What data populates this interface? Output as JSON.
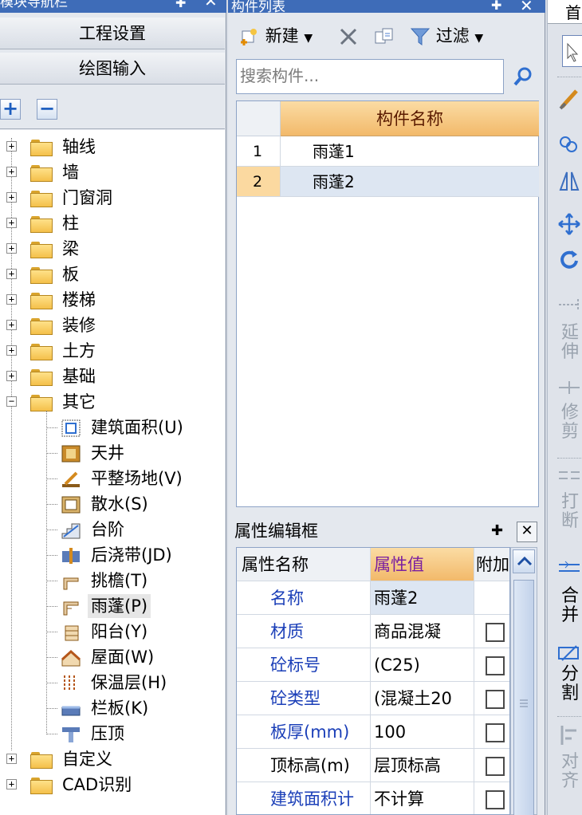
{
  "nav_panel": {
    "title": "模块导航栏",
    "pin_icon": "pin-icon",
    "close_icon": "close-icon",
    "buttons": [
      "工程设置",
      "绘图输入"
    ],
    "expand_all": "+",
    "collapse_all": "−",
    "tree": [
      {
        "label": "轴线",
        "expander": "+"
      },
      {
        "label": "墙",
        "expander": "+"
      },
      {
        "label": "门窗洞",
        "expander": "+"
      },
      {
        "label": "柱",
        "expander": "+"
      },
      {
        "label": "梁",
        "expander": "+"
      },
      {
        "label": "板",
        "expander": "+"
      },
      {
        "label": "楼梯",
        "expander": "+"
      },
      {
        "label": "装修",
        "expander": "+"
      },
      {
        "label": "土方",
        "expander": "+"
      },
      {
        "label": "基础",
        "expander": "+"
      },
      {
        "label": "其它",
        "expander": "−"
      },
      {
        "label": "自定义",
        "expander": "+"
      },
      {
        "label": "CAD识别",
        "expander": "+"
      }
    ],
    "other_children": [
      {
        "label": "建筑面积(U)",
        "icon": "building-area-icon"
      },
      {
        "label": "天井",
        "icon": "courtyard-icon"
      },
      {
        "label": "平整场地(V)",
        "icon": "site-leveling-icon"
      },
      {
        "label": "散水(S)",
        "icon": "apron-icon"
      },
      {
        "label": "台阶",
        "icon": "steps-icon"
      },
      {
        "label": "后浇带(JD)",
        "icon": "post-cast-strip-icon"
      },
      {
        "label": "挑檐(T)",
        "icon": "cornice-icon"
      },
      {
        "label": "雨蓬(P)",
        "icon": "canopy-icon"
      },
      {
        "label": "阳台(Y)",
        "icon": "balcony-icon"
      },
      {
        "label": "屋面(W)",
        "icon": "roof-icon"
      },
      {
        "label": "保温层(H)",
        "icon": "insulation-icon"
      },
      {
        "label": "栏板(K)",
        "icon": "parapet-icon"
      },
      {
        "label": "压顶",
        "icon": "coping-icon"
      }
    ],
    "selected_child": "雨蓬(P)"
  },
  "component_list": {
    "title": "构件列表",
    "toolbar": {
      "new_label": "新建",
      "new_icon": "new-component-icon",
      "delete_icon": "delete-icon",
      "copy_icon": "copy-icon",
      "filter_label": "过滤",
      "filter_icon": "filter-icon"
    },
    "search": {
      "placeholder": "搜索构件...",
      "icon": "search-icon"
    },
    "column_header": "构件名称",
    "rows": [
      {
        "num": "1",
        "name": "雨蓬1"
      },
      {
        "num": "2",
        "name": "雨蓬2"
      }
    ],
    "selected_row": 2
  },
  "property_editor": {
    "title": "属性编辑框",
    "headers": [
      "属性名称",
      "属性值",
      "附加"
    ],
    "rows": [
      {
        "name": "名称",
        "value": "雨蓬2",
        "checkbox": false,
        "blue": true
      },
      {
        "name": "材质",
        "value": "商品混凝",
        "checkbox": true,
        "blue": true
      },
      {
        "name": "砼标号",
        "value": "(C25)",
        "checkbox": true,
        "blue": true
      },
      {
        "name": "砼类型",
        "value": "(混凝土20",
        "checkbox": true,
        "blue": true
      },
      {
        "name": "板厚(mm)",
        "value": "100",
        "checkbox": true,
        "blue": true
      },
      {
        "name": "顶标高(m)",
        "value": "层顶标高",
        "checkbox": true,
        "blue": false
      },
      {
        "name": "建筑面积计",
        "value": "不计算",
        "checkbox": true,
        "blue": true
      }
    ]
  },
  "right_toolbar": {
    "top_label": "首",
    "tools": [
      {
        "label": "延伸",
        "enabled": false
      },
      {
        "label": "修剪",
        "enabled": false
      },
      {
        "label": "打断",
        "enabled": false
      },
      {
        "label": "合并",
        "enabled": true
      },
      {
        "label": "分割",
        "enabled": true
      },
      {
        "label": "对齐",
        "enabled": false
      }
    ]
  },
  "colors": {
    "titlebar": "#3e6cb8",
    "header_orange": "#f2b96a",
    "selection_blue": "#dde6f2",
    "property_name_blue": "#1b3fb8"
  }
}
